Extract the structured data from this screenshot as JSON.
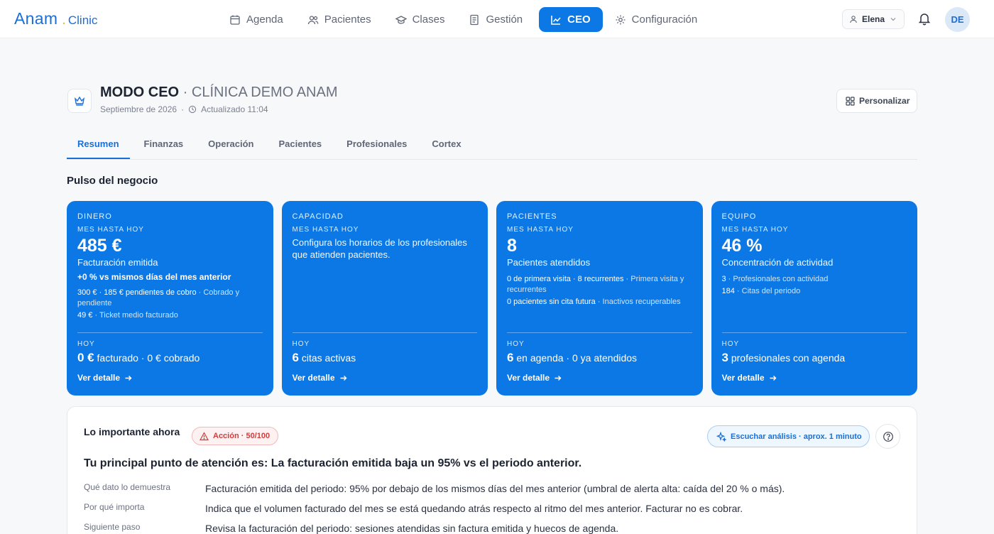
{
  "brand": {
    "name": "Anam",
    "suffix": "Clinic"
  },
  "nav": [
    {
      "label": "Agenda",
      "icon": "calendar-icon"
    },
    {
      "label": "Pacientes",
      "icon": "users-icon"
    },
    {
      "label": "Clases",
      "icon": "cap-icon"
    },
    {
      "label": "Gestión",
      "icon": "document-icon"
    },
    {
      "label": "CEO",
      "icon": "chart-icon",
      "active": true
    },
    {
      "label": "Configuración",
      "icon": "gear-icon"
    }
  ],
  "user": {
    "name": "Elena",
    "initials": "DE"
  },
  "header": {
    "mode": "MODO CEO",
    "separator": " · ",
    "clinic": "CLÍNICA DEMO ANAM",
    "month": "Septiembre de 2026",
    "dot": "·",
    "updated": "Actualizado 11:04",
    "customize": "Personalizar"
  },
  "tabs": [
    "Resumen",
    "Finanzas",
    "Operación",
    "Pacientes",
    "Profesionales",
    "Cortex"
  ],
  "section_title": "Pulso del negocio",
  "cards": {
    "money": {
      "label": "DINERO",
      "period": "MES HASTA HOY",
      "big": "485 €",
      "desc": "Facturación emitida",
      "delta": "+0 % vs mismos días del mes anterior",
      "d1_strong": "300 € · 185 € pendientes de cobro",
      "d1_muted": " · Cobrado y pendiente",
      "d2_strong": "49 €",
      "d2_muted": " · Ticket medio facturado",
      "today_label": "HOY",
      "today_big": "0 €",
      "today_rest": " facturado · 0 € cobrado",
      "link": "Ver detalle"
    },
    "capacity": {
      "label": "CAPACIDAD",
      "period": "MES HASTA HOY",
      "note": "Configura los horarios de los profesionales que atienden pacientes.",
      "today_label": "HOY",
      "today_big": "6",
      "today_rest": " citas activas",
      "link": "Ver detalle"
    },
    "patients": {
      "label": "PACIENTES",
      "period": "MES HASTA HOY",
      "big": "8",
      "desc": "Pacientes atendidos",
      "d1_strong": "0 de primera visita · 8 recurrentes",
      "d1_muted": " · Primera visita y recurrentes",
      "d2_strong": "0 pacientes sin cita futura",
      "d2_muted": " · Inactivos recuperables",
      "today_label": "HOY",
      "today_big": "6",
      "today_rest": " en agenda · 0 ya atendidos",
      "link": "Ver detalle"
    },
    "team": {
      "label": "EQUIPO",
      "period": "MES HASTA HOY",
      "big": "46 %",
      "desc": "Concentración de actividad",
      "d1_strong": "3",
      "d1_muted": " · Profesionales con actividad",
      "d2_strong": "184",
      "d2_muted": " · Citas del periodo",
      "today_label": "HOY",
      "today_big": "3",
      "today_rest": " profesionales con agenda",
      "link": "Ver detalle"
    }
  },
  "important": {
    "title": "Lo importante ahora",
    "badge": "Acción · 50/100",
    "listen": "Escuchar análisis · aprox. 1 minuto",
    "headline": "Tu principal punto de atención es: La facturación emitida baja un 95% vs el periodo anterior.",
    "rows": [
      {
        "label": "Qué dato lo demuestra",
        "text": "Facturación emitida del periodo: 95% por debajo de los mismos días del mes anterior (umbral de alerta alta: caída del 20 % o más)."
      },
      {
        "label": "Por qué importa",
        "text": "Indica que el volumen facturado del mes se está quedando atrás respecto al ritmo del mes anterior. Facturar no es cobrar."
      },
      {
        "label": "Siguiente paso",
        "text": "Revisa la facturación del periodo: sesiones atendidas sin factura emitida y huecos de agenda."
      }
    ]
  },
  "colors": {
    "accent": "#0b78e6",
    "brand": "#1a6fd6",
    "danger": "#d43b3b",
    "gold": "#e8b62e"
  }
}
